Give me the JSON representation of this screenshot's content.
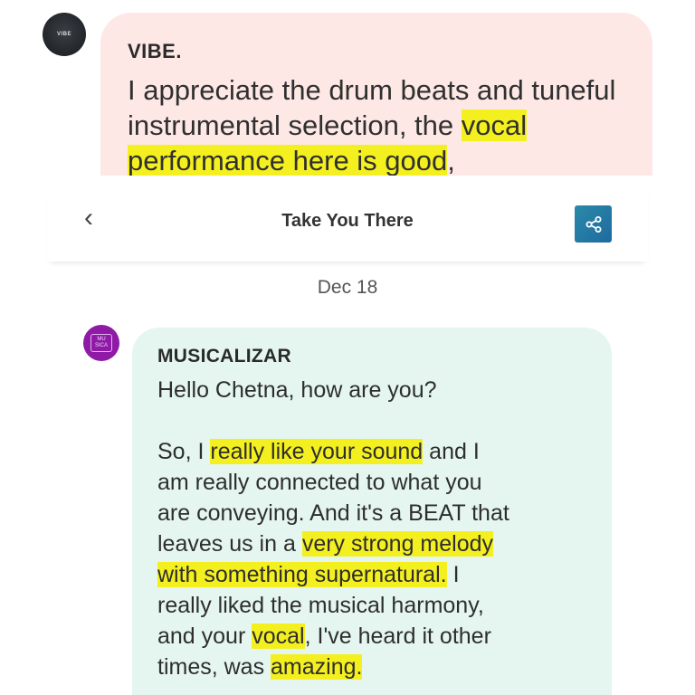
{
  "top_message": {
    "avatar_text": "VIBE",
    "sender": "VIBE.",
    "text_before": "I appreciate the drum beats and tuneful instrumental selection, the ",
    "text_highlight": "vocal performance here is good",
    "text_after": ","
  },
  "header": {
    "back_glyph": "‹",
    "title": "Take You There",
    "share_icon": "share-icon"
  },
  "date": "Dec 18",
  "message": {
    "avatar_text": "MUSICALIZAR",
    "sender": "MUSICALIZAR",
    "greeting": "Hello Chetna, how are you?",
    "lines": [
      {
        "a": " So, I ",
        "h": "really like your sound",
        "b": " and I"
      },
      {
        "a": "am really connected to what you",
        "h": "",
        "b": ""
      },
      {
        "a": "are conveying. And it's a BEAT that",
        "h": "",
        "b": ""
      },
      {
        "a": "leaves us in a ",
        "h": "very strong melody",
        "b": ""
      },
      {
        "a": "",
        "h": "with something supernatural.",
        "b": " I"
      },
      {
        "a": "really liked the musical harmony,",
        "h": "",
        "b": ""
      },
      {
        "a": "and your ",
        "h": "vocal",
        "b": ", I've heard it other"
      },
      {
        "a": "times, was ",
        "h": "amazing.",
        "b": ""
      }
    ]
  },
  "colors": {
    "highlight": "#f4f01f",
    "top_bubble": "#fde8e5",
    "message_bubble": "#e4f6ef",
    "share_button": "#1f6aa0"
  }
}
